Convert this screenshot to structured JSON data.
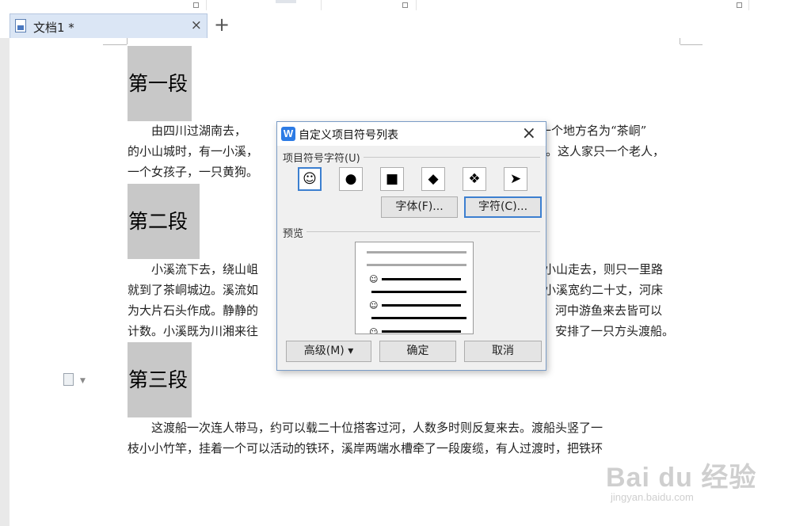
{
  "tab": {
    "title": "文档1 *",
    "close": "×",
    "new_tab": "+"
  },
  "document": {
    "headings": [
      "第一段",
      "第二段",
      "第三段"
    ],
    "paragraphs": [
      {
        "lines": [
          {
            "left": "　　由四川过湖南去，",
            "right": "一个地方名为“茶峒”"
          },
          {
            "left": "的小山城时，有一小溪，",
            "right": "。这人家只一个老人，"
          },
          {
            "left": "一个女孩子，一只黄狗。",
            "right": ""
          }
        ]
      },
      {
        "lines": [
          {
            "left": "　　小溪流下去，绕山岨",
            "right": "小山走去，则只一里路"
          },
          {
            "left": "就到了茶峒城边。溪流如",
            "right": "小溪宽约二十丈，河床"
          },
          {
            "left": "为大片石头作成。静静的",
            "right": "河中游鱼来去皆可以"
          },
          {
            "left": "计数。小溪既为川湘来往",
            "right": "安排了一只方头渡船。"
          }
        ]
      },
      {
        "lines": [
          {
            "left": "　　这渡船一次连人带马，约可以载二十位搭客过河，人数多时则反复来去。渡船头竖了一",
            "right": ""
          },
          {
            "left": "枝小小竹竿，挂着一个可以活动的铁环，溪岸两端水槽牵了一段废缆，有人过渡时，把铁环",
            "right": ""
          }
        ]
      }
    ]
  },
  "dialog": {
    "title": "自定义项目符号列表",
    "app_icon_letter": "W",
    "close": "×",
    "symbol_group_label": "项目符号字符(U)",
    "symbols": [
      {
        "glyph": "☺",
        "name": "smiley"
      },
      {
        "glyph": "●",
        "name": "circle"
      },
      {
        "glyph": "■",
        "name": "square"
      },
      {
        "glyph": "◆",
        "name": "diamond"
      },
      {
        "glyph": "❖",
        "name": "four-diamond"
      },
      {
        "glyph": "➤",
        "name": "arrow"
      }
    ],
    "font_button": "字体(F)...",
    "char_button": "字符(C)...",
    "preview_label": "预览",
    "preview_bullet": "☺",
    "advanced_button": "高级(M) ▾",
    "ok_button": "确定",
    "cancel_button": "取消"
  },
  "watermark": {
    "brand": "Bai du 经验",
    "url": "jingyan.baidu.com"
  },
  "colors": {
    "tab_bg": "#dbe6f5",
    "heading_bg": "#c8c8c8",
    "dialog_bg": "#f0f0f0",
    "focus_border": "#3c7fd0",
    "app_icon": "#2c7be5"
  }
}
